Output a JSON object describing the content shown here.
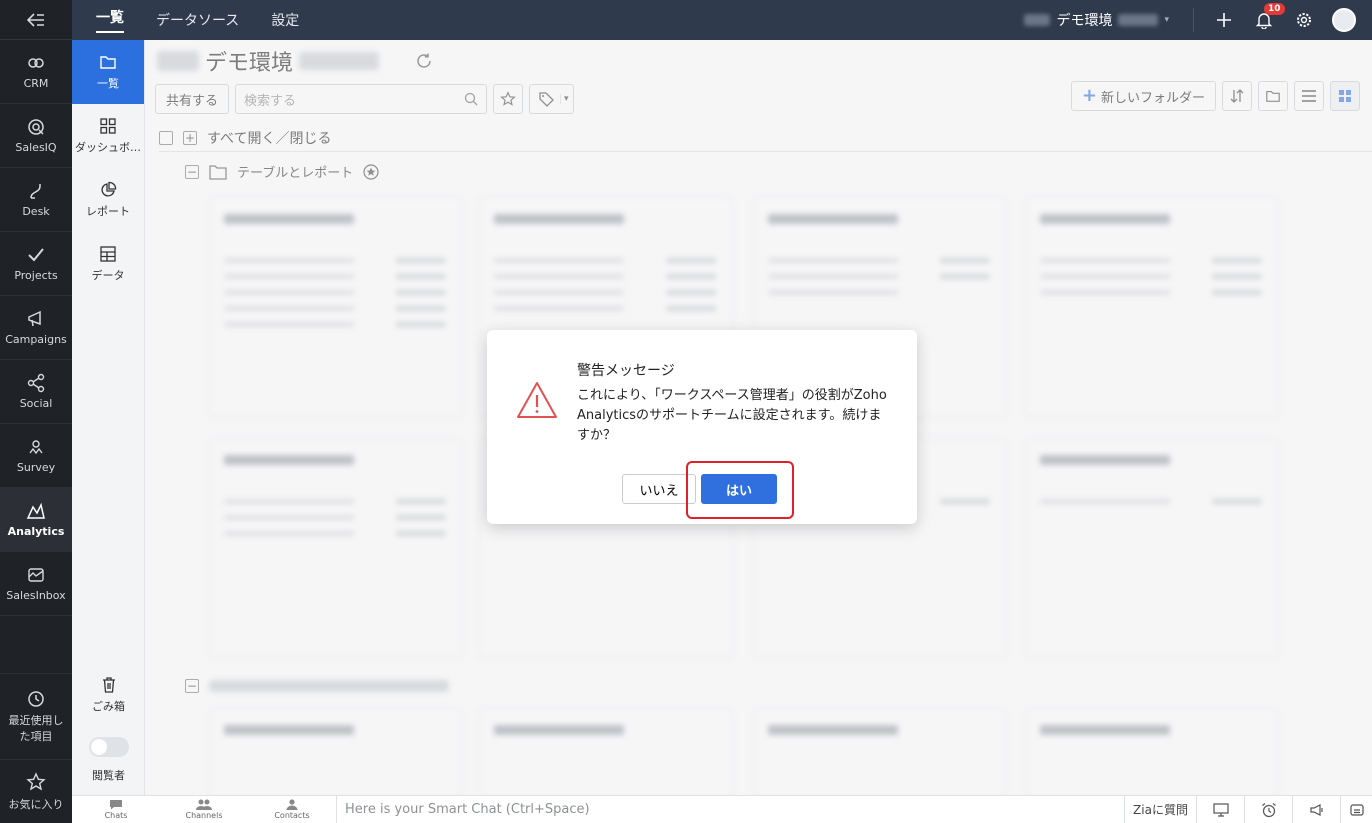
{
  "rail": {
    "items": [
      {
        "label": "CRM",
        "icon": "crm-icon"
      },
      {
        "label": "SalesIQ",
        "icon": "salesiq-icon"
      },
      {
        "label": "Desk",
        "icon": "desk-icon"
      },
      {
        "label": "Projects",
        "icon": "projects-icon"
      },
      {
        "label": "Campaigns",
        "icon": "campaigns-icon"
      },
      {
        "label": "Social",
        "icon": "social-icon"
      },
      {
        "label": "Survey",
        "icon": "survey-icon"
      },
      {
        "label": "Analytics",
        "icon": "analytics-icon"
      },
      {
        "label": "SalesInbox",
        "icon": "salesinbox-icon"
      }
    ],
    "recent_label": "最近使用した項目",
    "favorites_label": "お気に入り"
  },
  "topbar": {
    "tabs": [
      "一覧",
      "データソース",
      "設定"
    ],
    "workspace": "デモ環境",
    "notification_count": "10"
  },
  "subnav": {
    "items": [
      "一覧",
      "ダッシュボ…",
      "レポート",
      "データ"
    ],
    "trash_label": "ごみ箱",
    "viewer_label": "閲覧者"
  },
  "main": {
    "title": "デモ環境",
    "share_label": "共有する",
    "search_placeholder": "検索する",
    "new_folder_label": "新しいフォルダー",
    "expand_all_label": "すべて開く／閉じる",
    "folder_name": "テーブルとレポート"
  },
  "dialog": {
    "title": "警告メッセージ",
    "message": "これにより、「ワークスペース管理者」の役割がZoho Analyticsのサポートチームに設定されます。続けますか？",
    "no_label": "いいえ",
    "yes_label": "はい"
  },
  "bottombar": {
    "chats": "Chats",
    "channels": "Channels",
    "contacts": "Contacts",
    "smartchat_placeholder": "Here is your Smart Chat (Ctrl+Space)",
    "zia_label": "Ziaに質問"
  },
  "colors": {
    "accent": "#2f6fde",
    "rail_bg": "#1f2226",
    "topbar_bg": "#2f3b4d",
    "warning": "#e0202a"
  }
}
